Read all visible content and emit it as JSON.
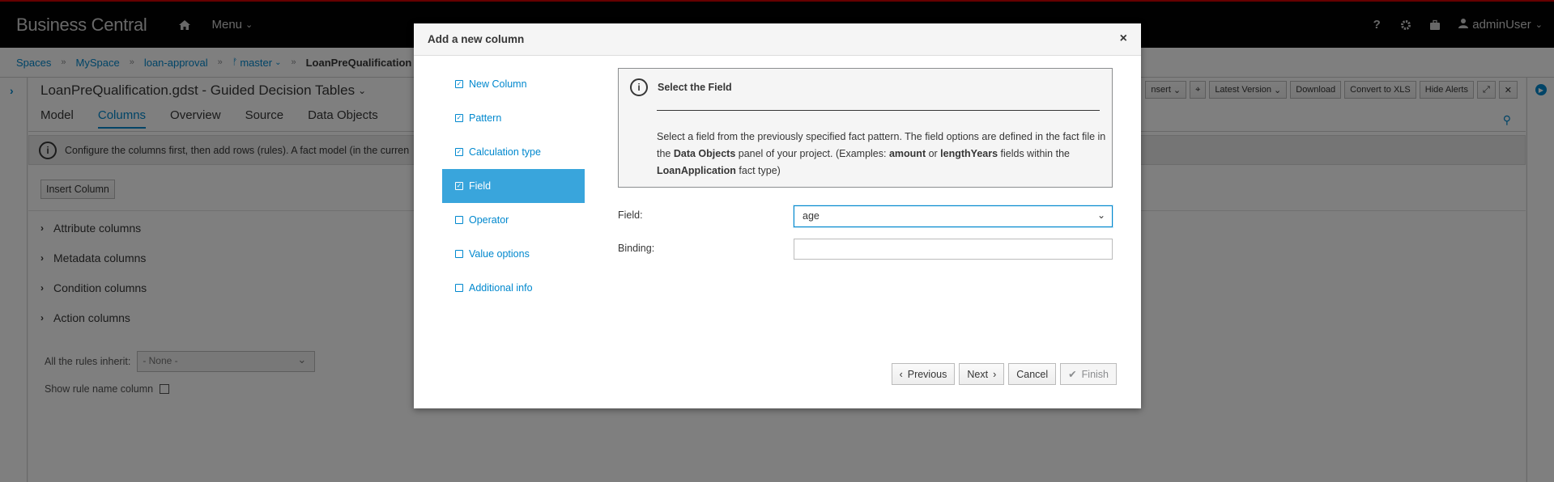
{
  "app": {
    "brand": "Business Central",
    "menu_label": "Menu",
    "user_label": "adminUser"
  },
  "breadcrumb": {
    "items": [
      "Spaces",
      "MySpace",
      "loan-approval",
      "master"
    ],
    "current": "LoanPreQualification"
  },
  "editor": {
    "title": "LoanPreQualification.gdst - Guided Decision Tables",
    "tabs": [
      "Model",
      "Columns",
      "Overview",
      "Source",
      "Data Objects"
    ],
    "active_tab": "Columns",
    "toolbar": [
      "nsert",
      "Latest Version",
      "Download",
      "Convert to XLS",
      "Hide Alerts"
    ],
    "info_text": "Configure the columns first, then add rows (rules). A fact model (in the curren",
    "insert_column_label": "Insert Column",
    "sections": [
      "Attribute columns",
      "Metadata columns",
      "Condition columns",
      "Action columns"
    ],
    "inherit_label": "All the rules inherit:",
    "inherit_value": "- None -",
    "show_rule_name_label": "Show rule name column"
  },
  "modal": {
    "title": "Add a new column",
    "close_symbol": "×",
    "steps": [
      {
        "label": "New Column",
        "done": true
      },
      {
        "label": "Pattern",
        "done": true
      },
      {
        "label": "Calculation type",
        "done": true
      },
      {
        "label": "Field",
        "done": true,
        "active": true
      },
      {
        "label": "Operator",
        "done": false
      },
      {
        "label": "Value options",
        "done": false
      },
      {
        "label": "Additional info",
        "done": false
      }
    ],
    "panel": {
      "title": "Select the Field",
      "text_1": "Select a field from the previously specified fact pattern. The field options are defined in the fact file in the ",
      "bold_1": "Data Objects",
      "text_2": " panel of your project. (Examples: ",
      "bold_2": "amount",
      "text_3": " or ",
      "bold_3": "lengthYears",
      "text_4": " fields within the ",
      "bold_4": "LoanApplication",
      "text_5": " fact type)"
    },
    "field_label": "Field:",
    "field_value": "age",
    "binding_label": "Binding:",
    "binding_value": "",
    "buttons": {
      "previous": "Previous",
      "next": "Next",
      "cancel": "Cancel",
      "finish": "Finish"
    }
  },
  "colors": {
    "accent": "#0088ce",
    "active_step": "#39a5dc",
    "navbar": "#030303"
  }
}
